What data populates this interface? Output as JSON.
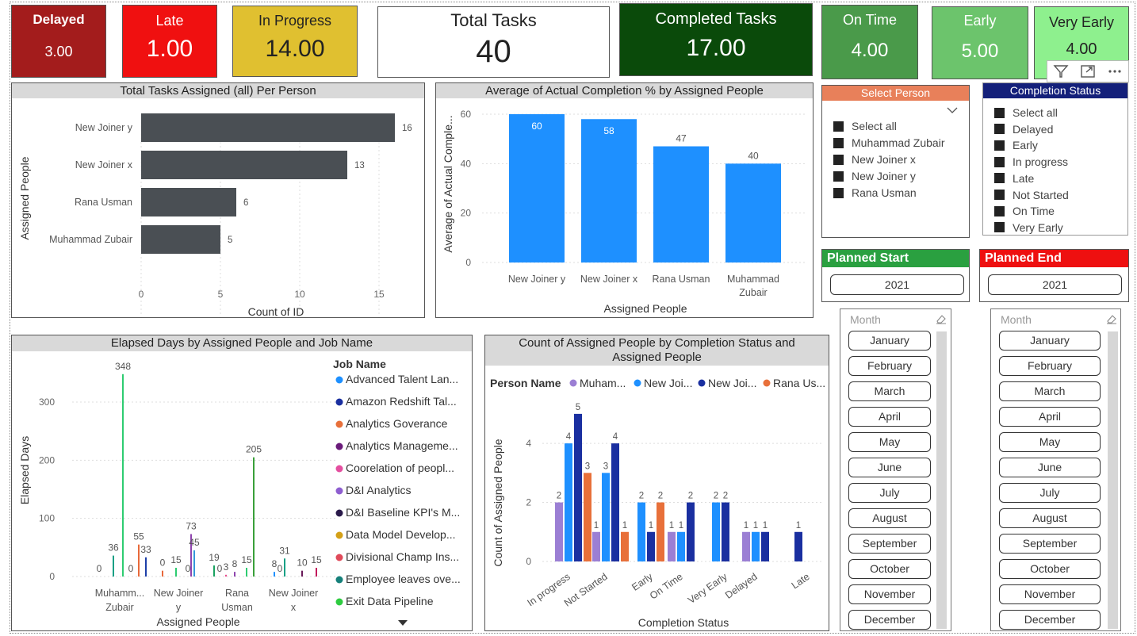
{
  "kpis": {
    "delayed": {
      "label": "Delayed",
      "value": "3.00",
      "bg": "#a31c1c",
      "fg": "#ffffff"
    },
    "late": {
      "label": "Late",
      "value": "1.00",
      "bg": "#f01010",
      "fg": "#ffffff"
    },
    "in_progress": {
      "label": "In Progress",
      "value": "14.00",
      "bg": "#e0c030",
      "fg": "#222222"
    },
    "total_tasks": {
      "label": "Total Tasks",
      "value": "40",
      "bg": "#ffffff",
      "fg": "#222222"
    },
    "completed_tasks": {
      "label": "Completed Tasks",
      "value": "17.00",
      "bg": "#0a4a0a",
      "fg": "#ffffff"
    },
    "on_time": {
      "label": "On Time",
      "value": "4.00",
      "bg": "#4a9a4a",
      "fg": "#ffffff"
    },
    "early": {
      "label": "Early",
      "value": "5.00",
      "bg": "#6cc46c",
      "fg": "#ffffff"
    },
    "very_early": {
      "label": "Very Early",
      "value": "4.00",
      "bg": "#8ef08e",
      "fg": "#222222"
    }
  },
  "chart_data": [
    {
      "type": "bar",
      "orientation": "horizontal",
      "title": "Total Tasks Assigned (all) Per Person",
      "xlabel": "Count of ID",
      "ylabel": "Assigned People",
      "categories": [
        "New Joiner y",
        "New Joiner x",
        "Rana Usman",
        "Muhammad Zubair"
      ],
      "values": [
        16,
        13,
        6,
        5
      ],
      "xticks": [
        "0",
        "5",
        "10",
        "15"
      ],
      "xlim": [
        0,
        17
      ],
      "color": "#4a4f54"
    },
    {
      "type": "bar",
      "title": "Average of Actual Completion % by Assigned People",
      "xlabel": "Assigned People",
      "ylabel": "Average of Actual Comple...",
      "categories": [
        "New Joiner y",
        "New Joiner x",
        "Rana Usman",
        "Muhammad Zubair"
      ],
      "values": [
        60,
        58,
        47,
        40
      ],
      "yticks": [
        "0",
        "20",
        "40",
        "60"
      ],
      "ylim": [
        0,
        60
      ],
      "color": "#1e90ff"
    },
    {
      "type": "bar",
      "title": "Elapsed Days by Assigned People and Job Name",
      "xlabel": "Assigned People",
      "ylabel": "Elapsed Days",
      "legend_title": "Job Name",
      "categories": [
        "Muhamm... Zubair",
        "New Joiner y",
        "Rana Usman",
        "New Joiner x"
      ],
      "yticks": [
        "0",
        "100",
        "200",
        "300"
      ],
      "ylim": [
        0,
        360
      ],
      "data_labels": [
        [
          "0",
          "36",
          "348",
          "0",
          "55"
        ],
        [
          "33",
          "0",
          "15",
          "0",
          "73",
          "45"
        ],
        [
          "19",
          "0",
          "3",
          "8",
          "15",
          "205"
        ],
        [
          "8",
          "0",
          "31",
          "10",
          "15"
        ]
      ],
      "bars": [
        [
          {
            "v": 0,
            "c": "#1aa260"
          },
          {
            "v": 36,
            "c": "#16a085"
          },
          {
            "v": 348,
            "c": "#2ecc71"
          },
          {
            "v": 0,
            "c": "#e67e22"
          },
          {
            "v": 55,
            "c": "#e86a3a"
          }
        ],
        [
          {
            "v": 33,
            "c": "#1d3fa8"
          },
          {
            "v": 10,
            "c": "#e8683a"
          },
          {
            "v": 15,
            "c": "#2ecc71"
          },
          {
            "v": 0,
            "c": "#2980b9"
          },
          {
            "v": 73,
            "c": "#8e44ad"
          },
          {
            "v": 45,
            "c": "#3498db"
          }
        ],
        [
          {
            "v": 19,
            "c": "#1aa260"
          },
          {
            "v": 0,
            "c": "#2980b9"
          },
          {
            "v": 3,
            "c": "#e74c8c"
          },
          {
            "v": 8,
            "c": "#8e44ad"
          },
          {
            "v": 15,
            "c": "#2ecc71"
          },
          {
            "v": 205,
            "c": "#3aa03a"
          }
        ],
        [
          {
            "v": 8,
            "c": "#1e90ff"
          },
          {
            "v": 0,
            "c": "#2980b9"
          },
          {
            "v": 31,
            "c": "#16a085"
          },
          {
            "v": 10,
            "c": "#6a1b5a"
          },
          {
            "v": 15,
            "c": "#c2185b"
          }
        ]
      ],
      "legend": [
        {
          "name": "Advanced Talent Lan...",
          "color": "#1e90ff"
        },
        {
          "name": "Amazon Redshift Tal...",
          "color": "#1a2fa0"
        },
        {
          "name": "Analytics Goverance",
          "color": "#e8703a"
        },
        {
          "name": "Analytics Manageme...",
          "color": "#6a1b7a"
        },
        {
          "name": "Coorelation of peopl...",
          "color": "#e44fa0"
        },
        {
          "name": "D&I Analytics",
          "color": "#8e5ed0"
        },
        {
          "name": "D&I Baseline KPI's M...",
          "color": "#2a1a4a"
        },
        {
          "name": "Data Model Develop...",
          "color": "#d4a017"
        },
        {
          "name": "Divisional Champ Ins...",
          "color": "#e04a5a"
        },
        {
          "name": "Employee leaves ove...",
          "color": "#16807a"
        },
        {
          "name": "Exit Data Pipeline",
          "color": "#2ecc40"
        }
      ]
    },
    {
      "type": "bar",
      "title": "Count of Assigned People by Completion Status and Assigned People",
      "xlabel": "Completion Status",
      "ylabel": "Count of Assigned People",
      "legend_title": "Person Name",
      "categories": [
        "In progress",
        "Not Started",
        "Early",
        "On Time",
        "Very Early",
        "Delayed",
        "Late"
      ],
      "yticks": [
        "0",
        "2",
        "4"
      ],
      "ylim": [
        0,
        5.4
      ],
      "series": [
        {
          "name": "Muham...",
          "color": "#9b7fd4",
          "values": [
            2,
            1,
            null,
            1,
            null,
            1,
            null
          ]
        },
        {
          "name": "New Joi...",
          "color": "#1e90ff",
          "values": [
            4,
            3,
            2,
            1,
            2,
            1,
            null
          ]
        },
        {
          "name": "New Joi...",
          "color": "#1a2fa0",
          "values": [
            5,
            4,
            1,
            2,
            2,
            1,
            1
          ]
        },
        {
          "name": "Rana Us...",
          "color": "#e8703a",
          "values": [
            3,
            1,
            2,
            null,
            null,
            null,
            null
          ]
        }
      ]
    }
  ],
  "select_person": {
    "title": "Select Person",
    "items": [
      "Select all",
      "Muhammad Zubair",
      "New Joiner x",
      "New Joiner y",
      "Rana Usman"
    ]
  },
  "completion_status": {
    "title": "Completion Status",
    "items": [
      "Select all",
      "Delayed",
      "Early",
      "In progress",
      "Late",
      "Not Started",
      "On Time",
      "Very Early"
    ]
  },
  "planned_start": {
    "title": "Planned Start",
    "value": "2021"
  },
  "planned_end": {
    "title": "Planned End",
    "value": "2021"
  },
  "month_slicer_left": {
    "title": "Month",
    "months": [
      "January",
      "February",
      "March",
      "April",
      "May",
      "June",
      "July",
      "August",
      "September",
      "October",
      "November",
      "December"
    ]
  },
  "month_slicer_right": {
    "title": "Month",
    "months": [
      "January",
      "February",
      "March",
      "April",
      "May",
      "June",
      "July",
      "August",
      "September",
      "October",
      "November",
      "December"
    ]
  }
}
